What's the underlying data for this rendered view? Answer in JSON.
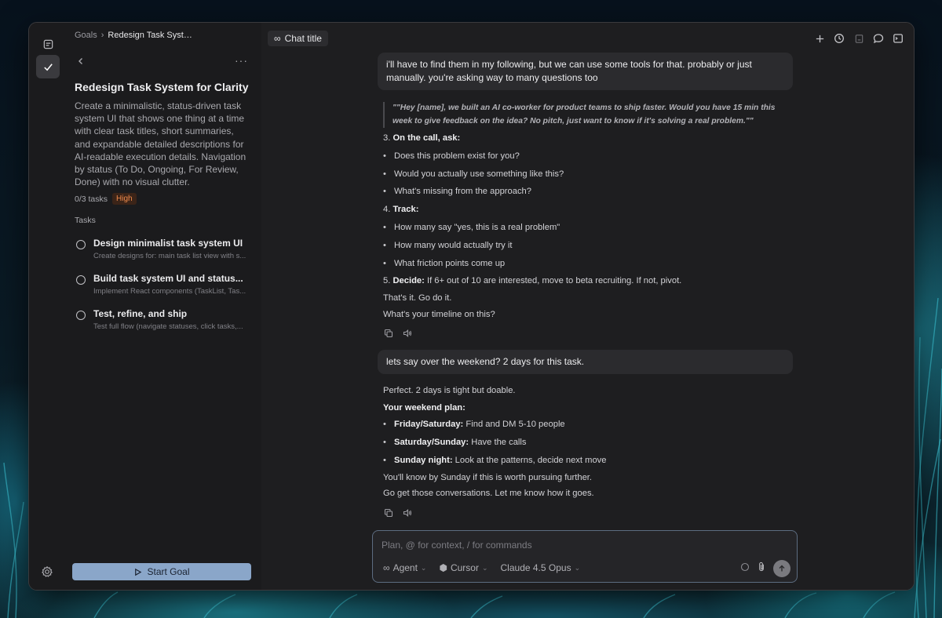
{
  "breadcrumb": {
    "root": "Goals",
    "current": "Redesign Task Syst…"
  },
  "goal": {
    "title": "Redesign Task System for Clarity",
    "description": "Create a minimalistic, status-driven task system UI that shows one thing at a time with clear task titles, short summaries, and expandable detailed descriptions for AI-readable execution details. Navigation by status (To Do, Ongoing, For Review, Done) with no visual clutter.",
    "task_count": "0/3 tasks",
    "priority": "High",
    "priority_color": "#f08a4b",
    "tasks_label": "Tasks",
    "tasks": [
      {
        "title": "Design minimalist task system UI",
        "summary": "Create designs for: main task list view with s..."
      },
      {
        "title": "Build task system UI and status...",
        "summary": "Implement React components (TaskList, Tas..."
      },
      {
        "title": "Test, refine, and ship",
        "summary": "Test full flow (navigate statuses, click tasks,..."
      }
    ],
    "start_button": "Start Goal",
    "start_button_color": "#8aa6c9"
  },
  "chat": {
    "title": "Chat title",
    "messages": {
      "user1": "i'll have to find them in my following, but we can use some tools for that. probably or just manually.  you're asking way to many questions too",
      "quote": "\"\"Hey [name], we built an AI co-worker for product teams to ship faster. Would you have 15 min this week to give feedback on the idea? No pitch, just want to know if it's solving a real problem.\"\"",
      "step3_num": "3.",
      "step3": "On the call, ask:",
      "step3_items": [
        "Does this problem exist for you?",
        "Would you actually use something like this?",
        "What's missing from the approach?"
      ],
      "step4_num": "4.",
      "step4": "Track:",
      "step4_items": [
        "How many say \"yes, this is a real problem\"",
        "How many would actually try it",
        "What friction points come up"
      ],
      "step5_num": "5.",
      "step5_bold": "Decide:",
      "step5_rest": " If 6+ out of 10 are interested, move to beta recruiting. If not, pivot.",
      "outro1": "That's it. Go do it.",
      "outro2": "What's your timeline on this?",
      "user2": "lets say over the weekend? 2 days for this task.",
      "reply_intro": "Perfect. 2 days is tight but doable.",
      "plan_heading": "Your weekend plan:",
      "plan": [
        {
          "bold": "Friday/Saturday:",
          "rest": " Find and DM 5-10 people"
        },
        {
          "bold": "Saturday/Sunday:",
          "rest": " Have the calls"
        },
        {
          "bold": "Sunday night:",
          "rest": " Look at the patterns, decide next move"
        }
      ],
      "closing1": "You'll know by Sunday if this is worth pursuing further.",
      "closing2": "Go get those conversations. Let me know how it goes."
    },
    "composer": {
      "placeholder": "Plan, @ for context, / for commands",
      "mode": "Agent",
      "provider": "Cursor",
      "model": "Claude 4.5 Opus"
    }
  }
}
